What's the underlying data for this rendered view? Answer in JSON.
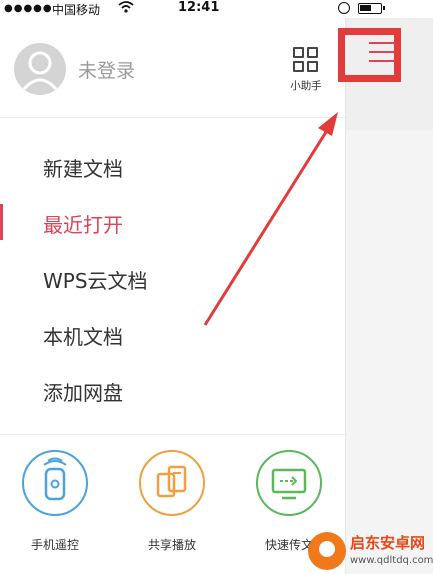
{
  "status_bar": {
    "signal": "●●●●●",
    "carrier": "中国移动",
    "time": "12:41"
  },
  "drawer": {
    "login_text": "未登录",
    "assistant_label": "小助手",
    "menu": [
      {
        "label": "新建文档",
        "active": false
      },
      {
        "label": "最近打开",
        "active": true
      },
      {
        "label": "WPS云文档",
        "active": false
      },
      {
        "label": "本机文档",
        "active": false
      },
      {
        "label": "添加网盘",
        "active": false
      }
    ],
    "tools": [
      {
        "label": "手机遥控",
        "icon": "phone-remote-icon",
        "color": "#4aa3df"
      },
      {
        "label": "共享播放",
        "icon": "share-play-icon",
        "color": "#f0a040"
      },
      {
        "label": "快速传文",
        "icon": "fast-transfer-icon",
        "color": "#5cb85c"
      }
    ]
  },
  "accent_color": "#e0425a",
  "annotation_color": "#e33a3a",
  "watermark": {
    "title": "启东安卓网",
    "url": "www.qdltdq.com"
  }
}
